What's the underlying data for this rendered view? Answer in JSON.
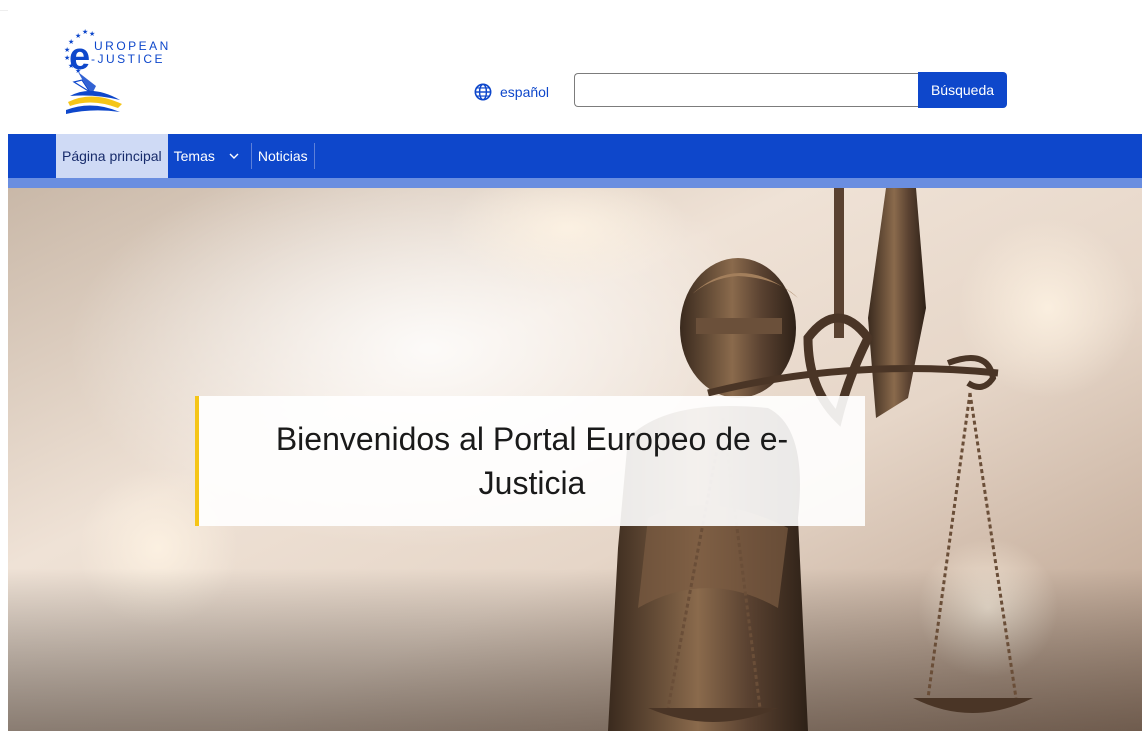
{
  "logo": {
    "line1": "UROPEAN",
    "line2": "-JUSTICE",
    "letter": "e",
    "alt": "European e-Justice"
  },
  "header": {
    "language_label": "español",
    "language_icon": "globe-icon",
    "search": {
      "value": "",
      "placeholder": "",
      "button_label": "Búsqueda"
    }
  },
  "nav": {
    "items": [
      {
        "label": "Página principal",
        "active": true
      },
      {
        "label": "Temas",
        "has_dropdown": true
      },
      {
        "label": "Noticias"
      }
    ]
  },
  "hero": {
    "title": "Bienvenidos al Portal Europeo de e-Justicia"
  },
  "colors": {
    "brand_blue": "#0e47cb",
    "nav_active_bg": "#cfdaf5",
    "accent_yellow": "#f5c518"
  }
}
